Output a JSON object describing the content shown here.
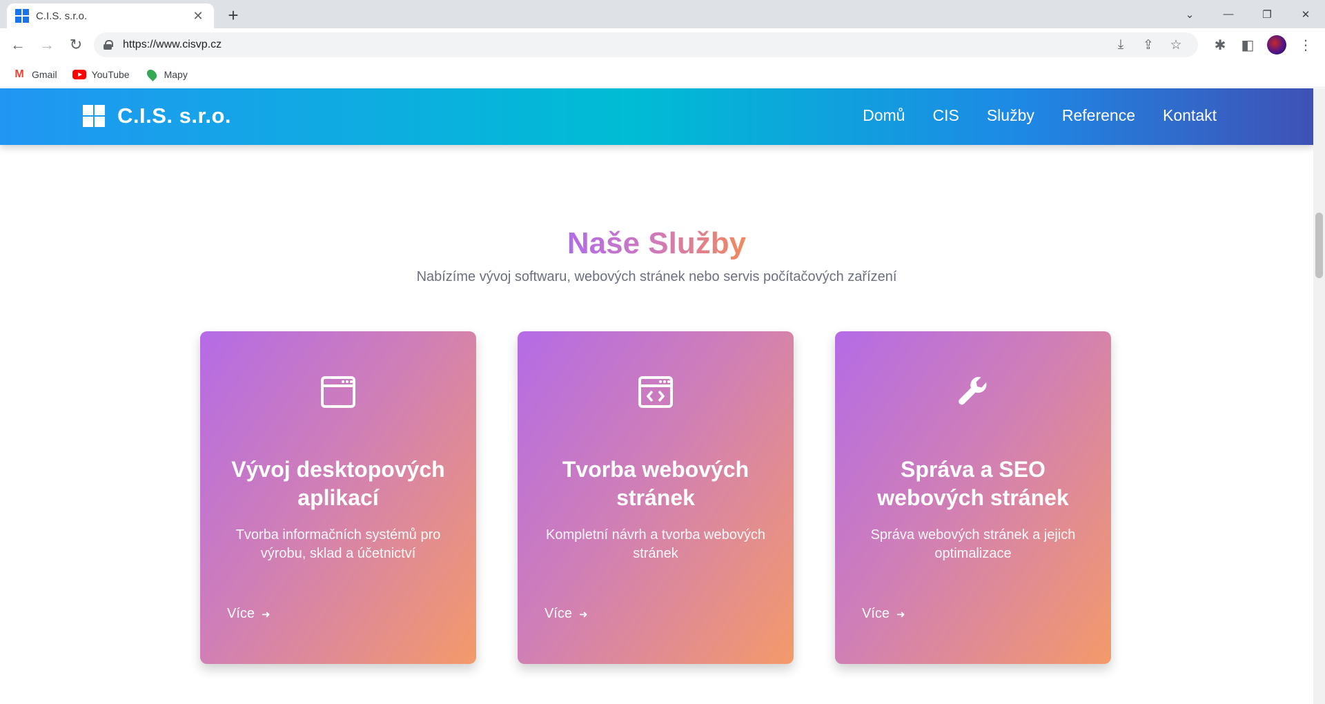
{
  "browser": {
    "tab_title": "C.I.S. s.r.o.",
    "tab_close": "✕",
    "new_tab": "+",
    "url": "https://www.cisvp.cz",
    "bookmarks": [
      "Gmail",
      "YouTube",
      "Mapy"
    ]
  },
  "site": {
    "brand": "C.I.S. s.r.o.",
    "nav": [
      "Domů",
      "CIS",
      "Služby",
      "Reference",
      "Kontakt"
    ]
  },
  "section": {
    "title": "Naše Služby",
    "subtitle": "Nabízíme vývoj softwaru, webových stránek nebo servis počítačových zařízení"
  },
  "cards": [
    {
      "icon": "browser-window-icon",
      "title": "Vývoj desktopových aplikací",
      "description": "Tvorba informačních systémů pro výrobu, sklad a účetnictví",
      "more": "Více"
    },
    {
      "icon": "code-window-icon",
      "title": "Tvorba webových stránek",
      "description": "Kompletní návrh a tvorba webových stránek",
      "more": "Více"
    },
    {
      "icon": "wrench-icon",
      "title": "Správa a SEO webových stránek",
      "description": "Správa webových stránek a jejich optimalizace",
      "more": "Více"
    }
  ],
  "colors": {
    "header_gradient": [
      "#2196f3",
      "#00bcd4",
      "#3f51b5"
    ],
    "card_gradient": [
      "#b46be6",
      "#f49a6a"
    ]
  }
}
